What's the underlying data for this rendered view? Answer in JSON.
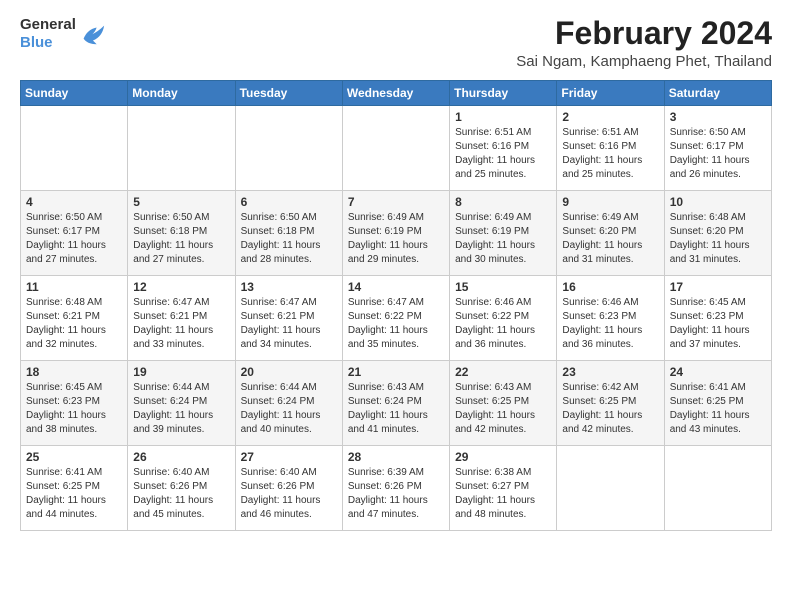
{
  "logo": {
    "general": "General",
    "blue": "Blue"
  },
  "title": "February 2024",
  "subtitle": "Sai Ngam, Kamphaeng Phet, Thailand",
  "days_header": [
    "Sunday",
    "Monday",
    "Tuesday",
    "Wednesday",
    "Thursday",
    "Friday",
    "Saturday"
  ],
  "weeks": [
    [
      {
        "num": "",
        "info": ""
      },
      {
        "num": "",
        "info": ""
      },
      {
        "num": "",
        "info": ""
      },
      {
        "num": "",
        "info": ""
      },
      {
        "num": "1",
        "info": "Sunrise: 6:51 AM\nSunset: 6:16 PM\nDaylight: 11 hours\nand 25 minutes."
      },
      {
        "num": "2",
        "info": "Sunrise: 6:51 AM\nSunset: 6:16 PM\nDaylight: 11 hours\nand 25 minutes."
      },
      {
        "num": "3",
        "info": "Sunrise: 6:50 AM\nSunset: 6:17 PM\nDaylight: 11 hours\nand 26 minutes."
      }
    ],
    [
      {
        "num": "4",
        "info": "Sunrise: 6:50 AM\nSunset: 6:17 PM\nDaylight: 11 hours\nand 27 minutes."
      },
      {
        "num": "5",
        "info": "Sunrise: 6:50 AM\nSunset: 6:18 PM\nDaylight: 11 hours\nand 27 minutes."
      },
      {
        "num": "6",
        "info": "Sunrise: 6:50 AM\nSunset: 6:18 PM\nDaylight: 11 hours\nand 28 minutes."
      },
      {
        "num": "7",
        "info": "Sunrise: 6:49 AM\nSunset: 6:19 PM\nDaylight: 11 hours\nand 29 minutes."
      },
      {
        "num": "8",
        "info": "Sunrise: 6:49 AM\nSunset: 6:19 PM\nDaylight: 11 hours\nand 30 minutes."
      },
      {
        "num": "9",
        "info": "Sunrise: 6:49 AM\nSunset: 6:20 PM\nDaylight: 11 hours\nand 31 minutes."
      },
      {
        "num": "10",
        "info": "Sunrise: 6:48 AM\nSunset: 6:20 PM\nDaylight: 11 hours\nand 31 minutes."
      }
    ],
    [
      {
        "num": "11",
        "info": "Sunrise: 6:48 AM\nSunset: 6:21 PM\nDaylight: 11 hours\nand 32 minutes."
      },
      {
        "num": "12",
        "info": "Sunrise: 6:47 AM\nSunset: 6:21 PM\nDaylight: 11 hours\nand 33 minutes."
      },
      {
        "num": "13",
        "info": "Sunrise: 6:47 AM\nSunset: 6:21 PM\nDaylight: 11 hours\nand 34 minutes."
      },
      {
        "num": "14",
        "info": "Sunrise: 6:47 AM\nSunset: 6:22 PM\nDaylight: 11 hours\nand 35 minutes."
      },
      {
        "num": "15",
        "info": "Sunrise: 6:46 AM\nSunset: 6:22 PM\nDaylight: 11 hours\nand 36 minutes."
      },
      {
        "num": "16",
        "info": "Sunrise: 6:46 AM\nSunset: 6:23 PM\nDaylight: 11 hours\nand 36 minutes."
      },
      {
        "num": "17",
        "info": "Sunrise: 6:45 AM\nSunset: 6:23 PM\nDaylight: 11 hours\nand 37 minutes."
      }
    ],
    [
      {
        "num": "18",
        "info": "Sunrise: 6:45 AM\nSunset: 6:23 PM\nDaylight: 11 hours\nand 38 minutes."
      },
      {
        "num": "19",
        "info": "Sunrise: 6:44 AM\nSunset: 6:24 PM\nDaylight: 11 hours\nand 39 minutes."
      },
      {
        "num": "20",
        "info": "Sunrise: 6:44 AM\nSunset: 6:24 PM\nDaylight: 11 hours\nand 40 minutes."
      },
      {
        "num": "21",
        "info": "Sunrise: 6:43 AM\nSunset: 6:24 PM\nDaylight: 11 hours\nand 41 minutes."
      },
      {
        "num": "22",
        "info": "Sunrise: 6:43 AM\nSunset: 6:25 PM\nDaylight: 11 hours\nand 42 minutes."
      },
      {
        "num": "23",
        "info": "Sunrise: 6:42 AM\nSunset: 6:25 PM\nDaylight: 11 hours\nand 42 minutes."
      },
      {
        "num": "24",
        "info": "Sunrise: 6:41 AM\nSunset: 6:25 PM\nDaylight: 11 hours\nand 43 minutes."
      }
    ],
    [
      {
        "num": "25",
        "info": "Sunrise: 6:41 AM\nSunset: 6:25 PM\nDaylight: 11 hours\nand 44 minutes."
      },
      {
        "num": "26",
        "info": "Sunrise: 6:40 AM\nSunset: 6:26 PM\nDaylight: 11 hours\nand 45 minutes."
      },
      {
        "num": "27",
        "info": "Sunrise: 6:40 AM\nSunset: 6:26 PM\nDaylight: 11 hours\nand 46 minutes."
      },
      {
        "num": "28",
        "info": "Sunrise: 6:39 AM\nSunset: 6:26 PM\nDaylight: 11 hours\nand 47 minutes."
      },
      {
        "num": "29",
        "info": "Sunrise: 6:38 AM\nSunset: 6:27 PM\nDaylight: 11 hours\nand 48 minutes."
      },
      {
        "num": "",
        "info": ""
      },
      {
        "num": "",
        "info": ""
      }
    ]
  ]
}
